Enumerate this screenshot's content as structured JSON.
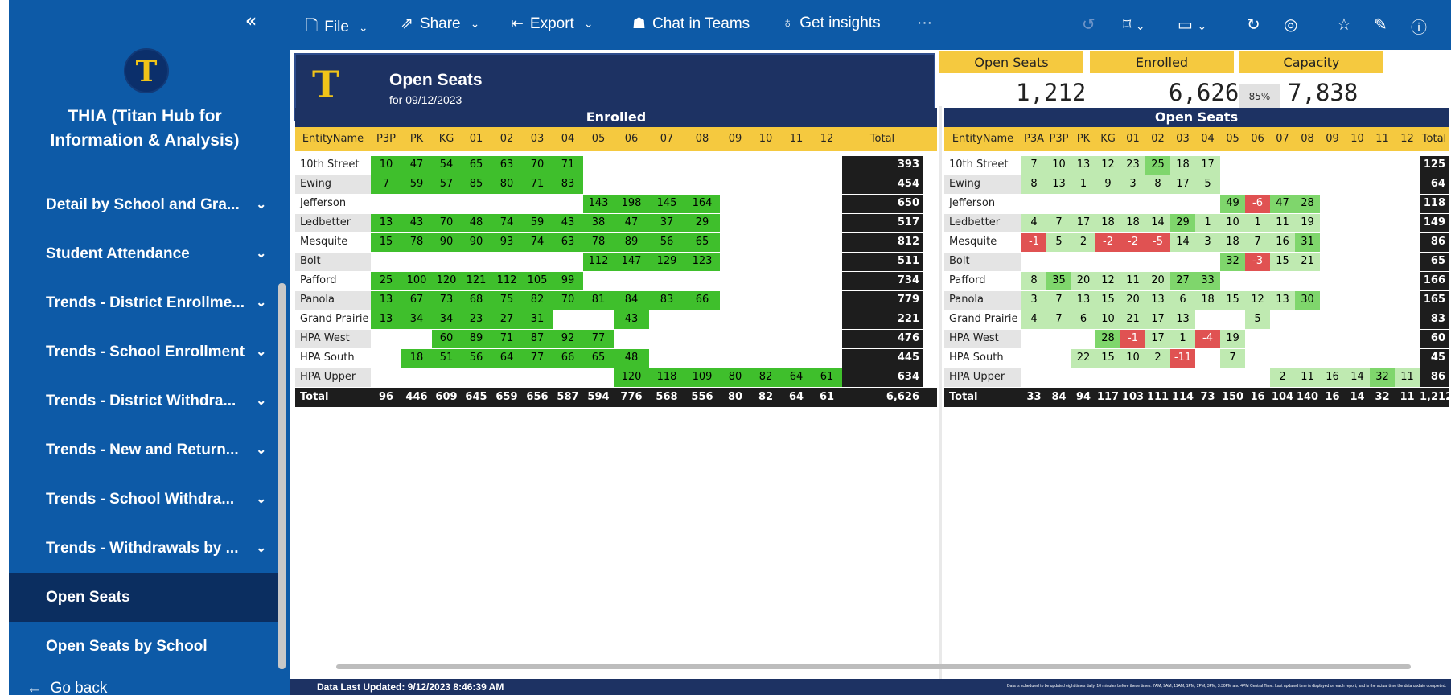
{
  "sidebar": {
    "collapse_icon": "double-chevron-left-icon",
    "app_title_line1": "THIA (Titan Hub for",
    "app_title_line2": "Information & Analysis)",
    "logo_letter": "T",
    "items": [
      {
        "label": "Detail by School and Gra...",
        "chevron": "⌄"
      },
      {
        "label": "Student Attendance",
        "chevron": "⌄"
      },
      {
        "label": "Trends - District Enrollme...",
        "chevron": "⌄"
      },
      {
        "label": "Trends - School Enrollment",
        "chevron": "⌄"
      },
      {
        "label": "Trends - District Withdra...",
        "chevron": "⌄"
      },
      {
        "label": "Trends - New and Return...",
        "chevron": "⌄"
      },
      {
        "label": "Trends - School Withdra...",
        "chevron": "⌄"
      },
      {
        "label": "Trends - Withdrawals by ...",
        "chevron": "⌄"
      },
      {
        "label": "Open Seats",
        "chevron": ""
      },
      {
        "label": "Open Seats by School",
        "chevron": ""
      }
    ],
    "go_back": "Go back"
  },
  "toolbar": {
    "file": "File",
    "share": "Share",
    "export": "Export",
    "chat": "Chat in Teams",
    "insights": "Get insights",
    "more": "···"
  },
  "header": {
    "logo_letter": "T",
    "title": "Open Seats",
    "subtitle": "for 09/12/2023"
  },
  "kpis": {
    "open_seats_label": "Open Seats",
    "open_seats_value": "1,212",
    "enrolled_label": "Enrolled",
    "enrolled_value": "6,626",
    "enrolled_pct": "85%",
    "capacity_label": "Capacity",
    "capacity_value": "7,838"
  },
  "enrolled": {
    "title": "Enrolled",
    "columns": [
      "EntityName",
      "P3P",
      "PK",
      "KG",
      "01",
      "02",
      "03",
      "04",
      "05",
      "06",
      "07",
      "08",
      "09",
      "10",
      "11",
      "12",
      "Total"
    ],
    "rows": [
      [
        "10th Street",
        "10",
        "47",
        "54",
        "65",
        "63",
        "70",
        "71",
        "",
        "",
        "",
        "",
        "",
        "",
        "",
        "",
        "393"
      ],
      [
        "Ewing",
        "7",
        "59",
        "57",
        "85",
        "80",
        "71",
        "83",
        "",
        "",
        "",
        "",
        "",
        "",
        "",
        "",
        "454"
      ],
      [
        "Jefferson",
        "",
        "",
        "",
        "",
        "",
        "",
        "",
        "143",
        "198",
        "145",
        "164",
        "",
        "",
        "",
        "",
        "650"
      ],
      [
        "Ledbetter",
        "13",
        "43",
        "70",
        "48",
        "74",
        "59",
        "43",
        "38",
        "47",
        "37",
        "29",
        "",
        "",
        "",
        "",
        "517"
      ],
      [
        "Mesquite",
        "15",
        "78",
        "90",
        "90",
        "93",
        "74",
        "63",
        "78",
        "89",
        "56",
        "65",
        "",
        "",
        "",
        "",
        "812"
      ],
      [
        "Bolt",
        "",
        "",
        "",
        "",
        "",
        "",
        "",
        "112",
        "147",
        "129",
        "123",
        "",
        "",
        "",
        "",
        "511"
      ],
      [
        "Pafford",
        "25",
        "100",
        "120",
        "121",
        "112",
        "105",
        "99",
        "",
        "",
        "",
        "",
        "",
        "",
        "",
        "",
        "734"
      ],
      [
        "Panola",
        "13",
        "67",
        "73",
        "68",
        "75",
        "82",
        "70",
        "81",
        "84",
        "83",
        "66",
        "",
        "",
        "",
        "",
        "779"
      ],
      [
        "Grand Prairie",
        "13",
        "34",
        "34",
        "23",
        "27",
        "31",
        "",
        "",
        "43",
        "",
        "",
        "",
        "",
        "",
        "",
        "221"
      ],
      [
        "HPA West",
        "",
        "",
        "60",
        "89",
        "71",
        "87",
        "92",
        "77",
        "",
        "",
        "",
        "",
        "",
        "",
        "",
        "476"
      ],
      [
        "HPA South",
        "",
        "18",
        "51",
        "56",
        "64",
        "77",
        "66",
        "65",
        "48",
        "",
        "",
        "",
        "",
        "",
        "",
        "445"
      ],
      [
        "HPA Upper",
        "",
        "",
        "",
        "",
        "",
        "",
        "",
        "",
        "120",
        "118",
        "109",
        "80",
        "82",
        "64",
        "61",
        "634"
      ]
    ],
    "total": [
      "Total",
      "96",
      "446",
      "609",
      "645",
      "659",
      "656",
      "587",
      "594",
      "776",
      "568",
      "556",
      "80",
      "82",
      "64",
      "61",
      "6,626"
    ]
  },
  "open_seats": {
    "title": "Open Seats",
    "columns": [
      "EntityName",
      "P3A",
      "P3P",
      "PK",
      "KG",
      "01",
      "02",
      "03",
      "04",
      "05",
      "06",
      "07",
      "08",
      "09",
      "10",
      "11",
      "12",
      "Total"
    ],
    "rows": [
      [
        "10th Street",
        "7",
        "10",
        "13",
        "12",
        "23",
        "25",
        "18",
        "17",
        "",
        "",
        "",
        "",
        "",
        "",
        "",
        "",
        "125"
      ],
      [
        "Ewing",
        "8",
        "13",
        "1",
        "9",
        "3",
        "8",
        "17",
        "5",
        "",
        "",
        "",
        "",
        "",
        "",
        "",
        "",
        "64"
      ],
      [
        "Jefferson",
        "",
        "",
        "",
        "",
        "",
        "",
        "",
        "",
        "49",
        "-6",
        "47",
        "28",
        "",
        "",
        "",
        "",
        "118"
      ],
      [
        "Ledbetter",
        "4",
        "7",
        "17",
        "18",
        "18",
        "14",
        "29",
        "1",
        "10",
        "1",
        "11",
        "19",
        "",
        "",
        "",
        "",
        "149"
      ],
      [
        "Mesquite",
        "-1",
        "5",
        "2",
        "-2",
        "-2",
        "-5",
        "14",
        "3",
        "18",
        "7",
        "16",
        "31",
        "",
        "",
        "",
        "",
        "86"
      ],
      [
        "Bolt",
        "",
        "",
        "",
        "",
        "",
        "",
        "",
        "",
        "32",
        "-3",
        "15",
        "21",
        "",
        "",
        "",
        "",
        "65"
      ],
      [
        "Pafford",
        "8",
        "35",
        "20",
        "12",
        "11",
        "20",
        "27",
        "33",
        "",
        "",
        "",
        "",
        "",
        "",
        "",
        "",
        "166"
      ],
      [
        "Panola",
        "3",
        "7",
        "13",
        "15",
        "20",
        "13",
        "6",
        "18",
        "15",
        "12",
        "13",
        "30",
        "",
        "",
        "",
        "",
        "165"
      ],
      [
        "Grand Prairie",
        "4",
        "7",
        "6",
        "10",
        "21",
        "17",
        "13",
        "",
        "",
        "5",
        "",
        "",
        "",
        "",
        "",
        "",
        "83"
      ],
      [
        "HPA West",
        "",
        "",
        "",
        "28",
        "-1",
        "17",
        "1",
        "-4",
        "19",
        "",
        "",
        "",
        "",
        "",
        "",
        "",
        "60"
      ],
      [
        "HPA South",
        "",
        "",
        "22",
        "15",
        "10",
        "2",
        "-11",
        "",
        "7",
        "",
        "",
        "",
        "",
        "",
        "",
        "",
        "45"
      ],
      [
        "HPA Upper",
        "",
        "",
        "",
        "",
        "",
        "",
        "",
        "",
        "",
        "",
        "2",
        "11",
        "16",
        "14",
        "32",
        "11",
        "86"
      ]
    ],
    "total": [
      "Total",
      "33",
      "84",
      "94",
      "117",
      "103",
      "111",
      "114",
      "73",
      "150",
      "16",
      "104",
      "140",
      "16",
      "14",
      "32",
      "11",
      "1,212"
    ]
  },
  "footer": {
    "last_updated": "Data Last Updated: 9/12/2023 8:46:39 AM",
    "schedule_note": "Data is scheduled to be updated eight times daily, 10 minutes before these times: 7AM, 9AM, 11AM, 1PM, 2PM, 3PM, 3:30PM and 4PM Central Time. Last updated time is displayed on each report, and is the actual time the data update completed."
  },
  "colors": {
    "nav_blue": "#0d5aa7",
    "navy": "#1d3263",
    "gold": "#f5c93f",
    "green_strong": "#3fbf2c",
    "green_mid": "#7fd66c",
    "green_light": "#bfeab1",
    "red": "#e05252"
  }
}
